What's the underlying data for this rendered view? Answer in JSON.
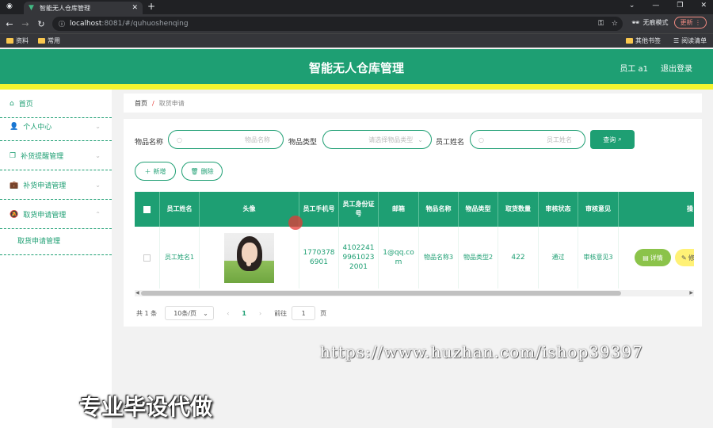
{
  "browser": {
    "tab_title": "智能无人仓库管理",
    "url_host": "localhost",
    "url_path": ":8081/#/quhuoshenqing",
    "incognito_label": "无痕模式",
    "update_label": "更新",
    "bookmarks": [
      "资料",
      "常用"
    ],
    "bookmarks_right": [
      "其他书签",
      "阅读清单"
    ]
  },
  "header": {
    "title": "智能无人仓库管理",
    "user": "员工 a1",
    "logout": "退出登录"
  },
  "sidebar": {
    "items": [
      {
        "label": "首页",
        "icon": "home-icon"
      },
      {
        "label": "个人中心",
        "icon": "user-icon"
      },
      {
        "label": "补货提醒管理",
        "icon": "copy-icon"
      },
      {
        "label": "补货申请管理",
        "icon": "briefcase-icon"
      },
      {
        "label": "取货申请管理",
        "icon": "bell-off-icon"
      }
    ],
    "subitems": [
      "取货申请管理"
    ]
  },
  "breadcrumb": {
    "home": "首页",
    "separator": "/",
    "current": "取货申请"
  },
  "filters": {
    "item_name_label": "物品名称",
    "item_name_placeholder": "物品名称",
    "item_type_label": "物品类型",
    "item_type_placeholder": "请选择物品类型",
    "employee_label": "员工姓名",
    "employee_placeholder": "员工姓名",
    "query_label": "查询"
  },
  "actions": {
    "add_label": "新增",
    "delete_label": "删除"
  },
  "table": {
    "headers": [
      "员工姓名",
      "头像",
      "员工手机号",
      "员工身份证号",
      "邮箱",
      "物品名称",
      "物品类型",
      "取货数量",
      "审核状态",
      "审核意见",
      "操"
    ],
    "rows": [
      {
        "employee_name": "员工姓名1",
        "phone": "17703786901",
        "id_card": "410224199610232001",
        "email": "1@qq.com",
        "item_name": "物品名称3",
        "item_type": "物品类型2",
        "quantity": "422",
        "status": "通过",
        "opinion": "审核意见3",
        "detail_label": "详情",
        "edit_label": "修"
      }
    ]
  },
  "pagination": {
    "total": "共 1 条",
    "page_size": "10条/页",
    "current_page": "1",
    "goto_label": "前往",
    "goto_value": "1",
    "page_suffix": "页"
  },
  "overlay": {
    "watermark": "https://www.huzhan.com/ishop39397",
    "caption": "专业毕设代做"
  },
  "colors": {
    "primary": "#1e9f73",
    "accent_stripe": "#f4f42f",
    "detail_button": "#8bc34a",
    "edit_button": "#fff176"
  }
}
